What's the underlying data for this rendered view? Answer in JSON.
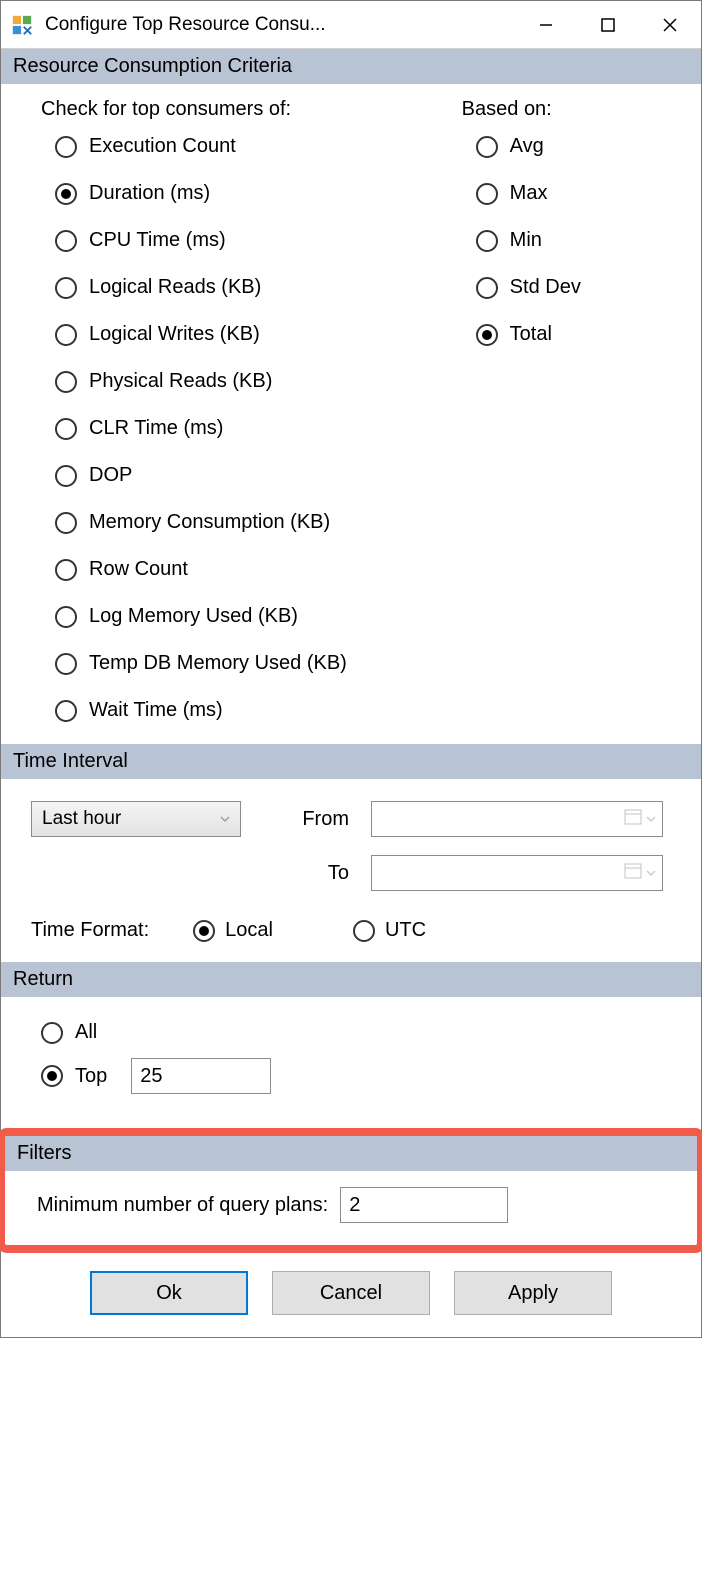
{
  "titlebar": {
    "title": "Configure Top Resource Consu..."
  },
  "criteria": {
    "section_label": "Resource Consumption Criteria",
    "consumers_heading": "Check for top consumers of:",
    "basedon_heading": "Based on:",
    "consumers": [
      {
        "label": "Execution Count",
        "checked": false
      },
      {
        "label": "Duration (ms)",
        "checked": true
      },
      {
        "label": "CPU Time (ms)",
        "checked": false
      },
      {
        "label": "Logical Reads (KB)",
        "checked": false
      },
      {
        "label": "Logical Writes (KB)",
        "checked": false
      },
      {
        "label": "Physical Reads (KB)",
        "checked": false
      },
      {
        "label": "CLR Time (ms)",
        "checked": false
      },
      {
        "label": "DOP",
        "checked": false
      },
      {
        "label": "Memory Consumption (KB)",
        "checked": false
      },
      {
        "label": "Row Count",
        "checked": false
      },
      {
        "label": "Log Memory Used (KB)",
        "checked": false
      },
      {
        "label": "Temp DB Memory Used (KB)",
        "checked": false
      },
      {
        "label": "Wait Time (ms)",
        "checked": false
      }
    ],
    "basedon": [
      {
        "label": "Avg",
        "checked": false
      },
      {
        "label": "Max",
        "checked": false
      },
      {
        "label": "Min",
        "checked": false
      },
      {
        "label": "Std Dev",
        "checked": false
      },
      {
        "label": "Total",
        "checked": true
      }
    ]
  },
  "time_interval": {
    "section_label": "Time Interval",
    "interval_value": "Last hour",
    "from_label": "From",
    "to_label": "To",
    "from_value": "",
    "to_value": "",
    "time_format_label": "Time Format:",
    "formats": [
      {
        "label": "Local",
        "checked": true
      },
      {
        "label": "UTC",
        "checked": false
      }
    ]
  },
  "return": {
    "section_label": "Return",
    "options": [
      {
        "label": "All",
        "checked": false
      },
      {
        "label": "Top",
        "checked": true
      }
    ],
    "top_value": "25"
  },
  "filters": {
    "section_label": "Filters",
    "min_plans_label": "Minimum number of query plans:",
    "min_plans_value": "2"
  },
  "buttons": {
    "ok": "Ok",
    "cancel": "Cancel",
    "apply": "Apply"
  }
}
